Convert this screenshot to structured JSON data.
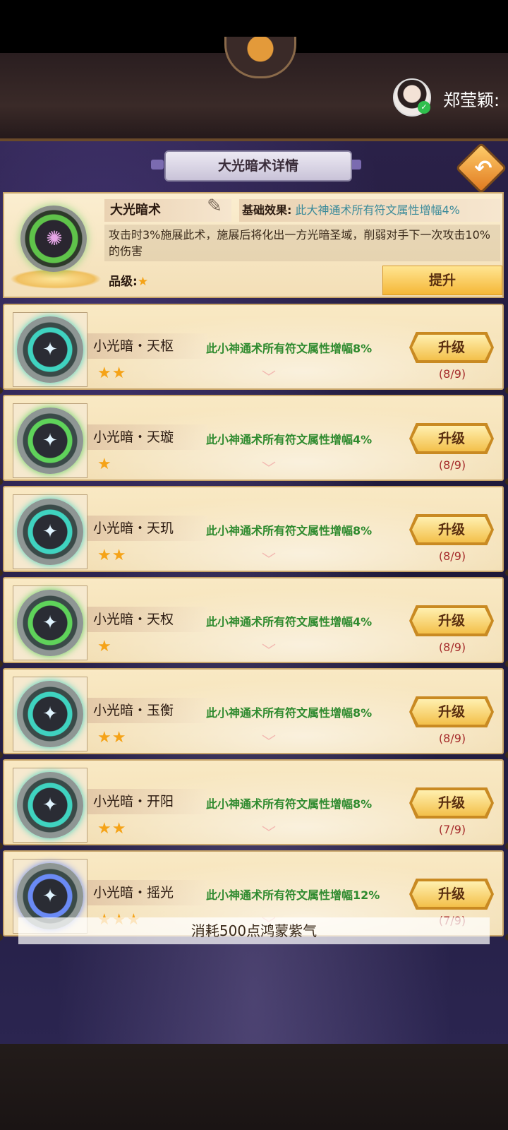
{
  "header": {
    "username": "郑莹颖:",
    "title": "大光暗术详情"
  },
  "detail": {
    "name": "大光暗术",
    "base_effect_label": "基础效果:",
    "base_effect_value": "此大神通术所有符文属性增幅4%",
    "description": "攻击时3%施展此术，施展后将化出一方光暗圣域，削弱对手下一次攻击10%的伤害",
    "grade_label": "品级:",
    "grade_stars": "★",
    "promote_label": "提升"
  },
  "rows": [
    {
      "name": "小光暗・天枢",
      "stars": "★★",
      "effect": "此小神通术所有符文属性增幅8%",
      "upgrade_label": "升级",
      "progress": "(8/9)",
      "color": "#3fd3c0"
    },
    {
      "name": "小光暗・天璇",
      "stars": "★",
      "effect": "此小神通术所有符文属性增幅4%",
      "upgrade_label": "升级",
      "progress": "(8/9)",
      "color": "#5fd35a"
    },
    {
      "name": "小光暗・天玑",
      "stars": "★★",
      "effect": "此小神通术所有符文属性增幅8%",
      "upgrade_label": "升级",
      "progress": "(8/9)",
      "color": "#3fd3c0"
    },
    {
      "name": "小光暗・天权",
      "stars": "★",
      "effect": "此小神通术所有符文属性增幅4%",
      "upgrade_label": "升级",
      "progress": "(8/9)",
      "color": "#5fd35a"
    },
    {
      "name": "小光暗・玉衡",
      "stars": "★★",
      "effect": "此小神通术所有符文属性增幅8%",
      "upgrade_label": "升级",
      "progress": "(8/9)",
      "color": "#3fd3c0"
    },
    {
      "name": "小光暗・开阳",
      "stars": "★★",
      "effect": "此小神通术所有符文属性增幅8%",
      "upgrade_label": "升级",
      "progress": "(7/9)",
      "color": "#3fd3c0"
    },
    {
      "name": "小光暗・摇光",
      "stars": "★★★",
      "effect": "此小神通术所有符文属性增幅12%",
      "upgrade_label": "升级",
      "progress": "(7/9)",
      "color": "#6a8af5"
    }
  ],
  "toast": "消耗500点鸿蒙紫气"
}
